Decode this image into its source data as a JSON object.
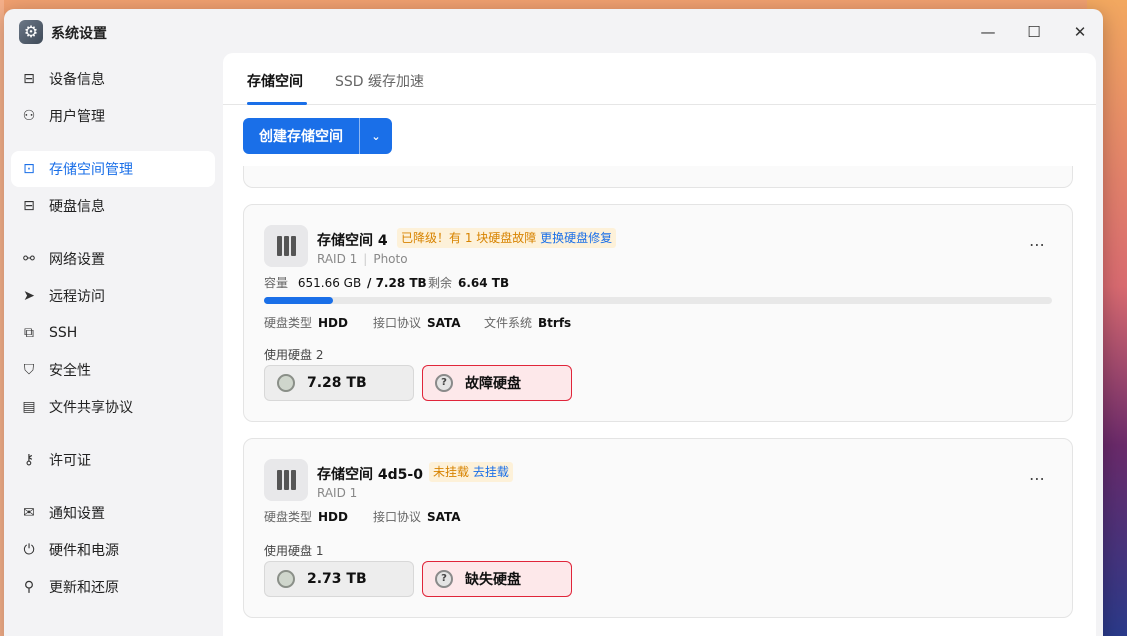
{
  "window": {
    "title": "系统设置"
  },
  "sidebar": {
    "items": [
      {
        "label": "设备信息",
        "icon": "device-icon"
      },
      {
        "label": "用户管理",
        "icon": "user-icon"
      },
      {
        "label": "存储空间管理",
        "icon": "storage-icon",
        "active": true
      },
      {
        "label": "硬盘信息",
        "icon": "disk-icon"
      },
      {
        "label": "网络设置",
        "icon": "network-icon"
      },
      {
        "label": "远程访问",
        "icon": "remote-icon"
      },
      {
        "label": "SSH",
        "icon": "ssh-icon"
      },
      {
        "label": "安全性",
        "icon": "shield-icon"
      },
      {
        "label": "文件共享协议",
        "icon": "file-share-icon"
      },
      {
        "label": "许可证",
        "icon": "key-icon"
      },
      {
        "label": "通知设置",
        "icon": "mail-icon"
      },
      {
        "label": "硬件和电源",
        "icon": "power-icon"
      },
      {
        "label": "更新和还原",
        "icon": "rocket-icon"
      }
    ]
  },
  "tabs": [
    {
      "label": "存储空间"
    },
    {
      "label": "SSD 缓存加速"
    }
  ],
  "create_button": {
    "label": "创建存储空间"
  },
  "cards": [
    {
      "title": "存储空间 4",
      "badge_warn": "已降级！有 1 块硬盘故障",
      "badge_link": "更换硬盘修复",
      "raid": "RAID 1",
      "tag": "Photo",
      "capacity_label": "容量",
      "capacity_used": "651.66 GB",
      "capacity_total": "/ 7.28 TB",
      "free_label": "剩余",
      "free_value": "6.64 TB",
      "usage_fraction": 0.088,
      "disk_type_label": "硬盘类型",
      "disk_type": "HDD",
      "interface_label": "接口协议",
      "interface": "SATA",
      "fs_label": "文件系统",
      "fs": "Btrfs",
      "used_disks_label": "使用硬盘 2",
      "disk_ok": "7.28 TB",
      "disk_bad": "故障硬盘"
    },
    {
      "title": "存储空间 4d5-0",
      "badge_warn": "未挂载",
      "badge_link": "去挂载",
      "raid": "RAID 1",
      "disk_type_label": "硬盘类型",
      "disk_type": "HDD",
      "interface_label": "接口协议",
      "interface": "SATA",
      "used_disks_label": "使用硬盘 1",
      "disk_ok": "2.73 TB",
      "disk_bad": "缺失硬盘"
    }
  ],
  "colors": {
    "accent": "#1a6fe8",
    "warn": "#d78300",
    "danger": "#e0253a"
  }
}
